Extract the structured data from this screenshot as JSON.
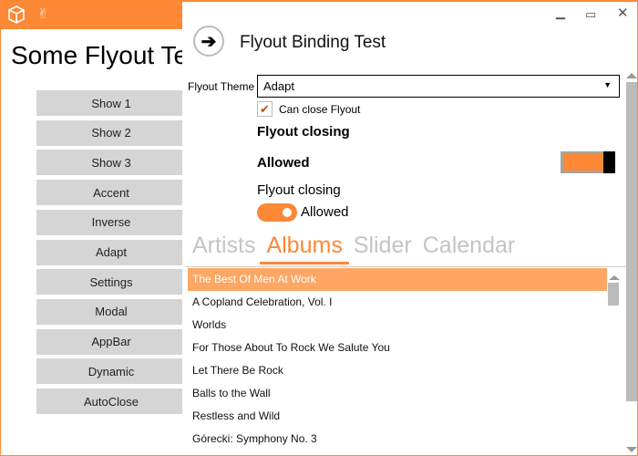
{
  "window": {
    "accent": "#fd8835",
    "icons": [
      "cube-icon",
      "victory-hand-icon"
    ],
    "main_title": "Some Flyout Te"
  },
  "buttons": [
    "Show 1",
    "Show 2",
    "Show 3",
    "Accent",
    "Inverse",
    "Adapt",
    "Settings",
    "Modal",
    "AppBar",
    "Dynamic",
    "AutoClose"
  ],
  "flyout": {
    "title": "Flyout Binding Test",
    "theme_label": "Flyout Theme",
    "theme_value": "Adapt",
    "can_close_label": "Can close Flyout",
    "can_close_checked": true,
    "closing_header": "Flyout closing",
    "closing_value": "Allowed",
    "toggle1_on": true,
    "closing_label2": "Flyout closing",
    "toggle2_label": "Allowed",
    "toggle2_on": true,
    "tabs": [
      "Artists",
      "Albums",
      "Slider",
      "Calendar"
    ],
    "active_tab": "Albums",
    "albums": [
      "The Best Of Men At Work",
      "A Copland Celebration, Vol. I",
      "Worlds",
      "For Those About To Rock We Salute You",
      "Let There Be Rock",
      "Balls to the Wall",
      "Restless and Wild",
      "Górecki: Symphony No. 3"
    ],
    "selected_album": "The Best Of Men At Work"
  }
}
